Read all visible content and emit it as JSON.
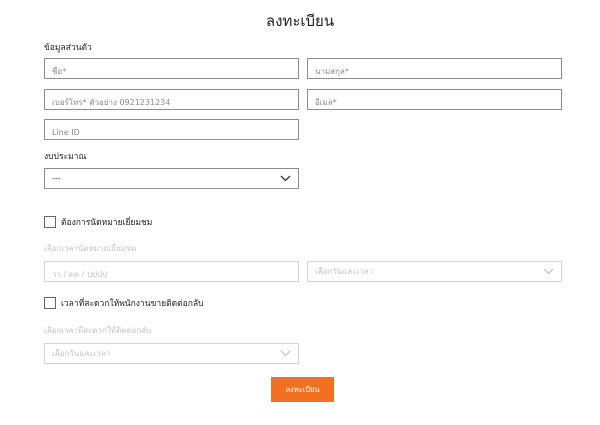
{
  "page": {
    "title": "ลงทะเบียน"
  },
  "personal": {
    "section_label": "ข้อมูลส่วนตัว",
    "first_name_placeholder": "ชื่อ*",
    "last_name_placeholder": "นามสกุล*",
    "phone_placeholder": "เบอร์โทร* ตัวอย่าง 0921231234",
    "email_placeholder": "อีเมล*",
    "line_placeholder": "Line ID"
  },
  "budget": {
    "section_label": "งบประมาณ",
    "selected": "---"
  },
  "appointment": {
    "checkbox_label": "ต้องการนัดหมายเยี่ยมชม",
    "hint": "เลือกเวลานัดหมายเยี่ยมชม",
    "date_placeholder": "วว / ดด / ปปปป",
    "time_placeholder": "เลือกวันและเวลา"
  },
  "callback": {
    "checkbox_label": "เวลาที่สะดวกให้พนักงานขายติดต่อกลับ",
    "hint": "เลือกเวลาที่สะดวกให้ติดต่อกลับ",
    "time_placeholder": "เลือกวันและเวลา"
  },
  "submit": {
    "label": "ลงทะเบียน",
    "color": "#f37021"
  },
  "icons": {
    "dropdown": "chevron-down-icon"
  }
}
